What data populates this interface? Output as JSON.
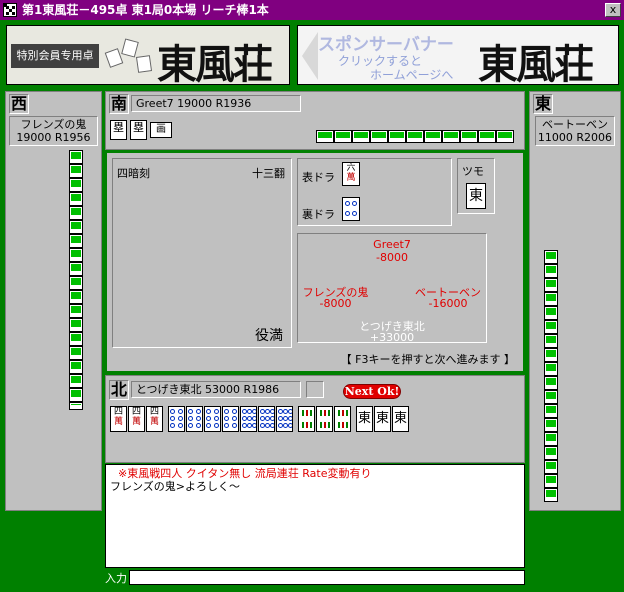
{
  "window": {
    "title": "第1東風荘－495卓 東1局0本場 リーチ棒1本",
    "close_label": "x"
  },
  "banners": {
    "left": {
      "text": "特別会員专用卓",
      "logo": "東風荘"
    },
    "right": {
      "line1": "スポンサーバナー",
      "line2": "クリックすると",
      "line3": "ホームページへ",
      "logo": "東風荘"
    }
  },
  "players": {
    "west": {
      "seat": "西",
      "name": "フレンズの鬼",
      "info": "19000 R1956"
    },
    "south": {
      "seat": "南",
      "info": "Greet7   19000 R1936"
    },
    "east": {
      "seat": "東",
      "name": "ベートーベン",
      "info": "11000 R2006"
    },
    "north": {
      "seat": "北",
      "info": "とつげき東北  53000 R1986"
    }
  },
  "result": {
    "yaku_name": "四暗刻",
    "han": "十三翻",
    "limit": "役満",
    "dora_label": "表ドラ",
    "ura_label": "裏ドラ",
    "tsumo_label": "ツモ",
    "tsumo_tile": "東",
    "hint": "【 F3キーを押すと次へ進みます 】"
  },
  "scores": {
    "p1_name": "Greet7",
    "p1_delta": "-8000",
    "p2_name": "フレンズの鬼",
    "p2_delta": "-8000",
    "p3_name": "ベートーベン",
    "p3_delta": "-16000",
    "p4_name": "とつげき東北",
    "p4_delta": "+33000"
  },
  "north_hand": {
    "next_label": "Next Ok!",
    "honor_tile": "東"
  },
  "chat": {
    "rules": "※東風戦四人 クイタン無し 流局連荘 Rate変動有り",
    "message": "フレンズの鬼>よろしく～",
    "input_label": "入力",
    "input_value": ""
  },
  "colors": {
    "title_bg": "#800080",
    "felt": "#008000",
    "accent_red": "#e00000"
  }
}
